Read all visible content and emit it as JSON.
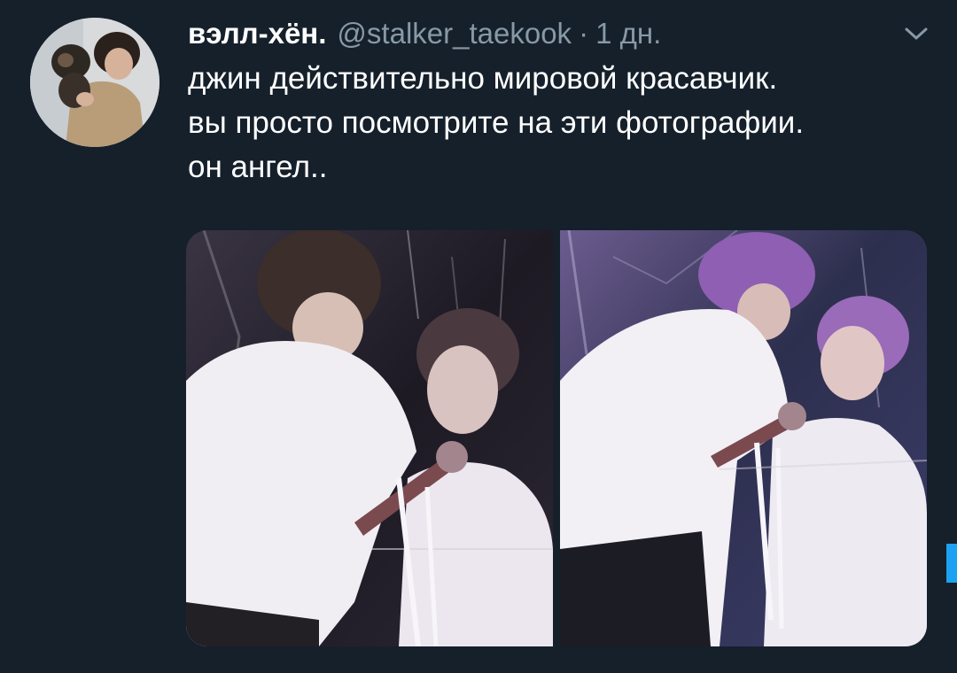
{
  "tweet": {
    "display_name": "вэлл-хён.",
    "handle": "@stalker_taekook",
    "separator": "·",
    "time": "1 дн.",
    "text_lines": [
      "джин действительно мировой красавчик.",
      "вы просто посмотрите на эти фотографии.",
      "он ангел.."
    ],
    "menu_icon": "chevron-down-icon",
    "media_count": 2
  },
  "colors": {
    "background": "#15202b",
    "secondary_text": "#8899a6",
    "primary_text": "#ffffff",
    "accent": "#1da1f2"
  }
}
